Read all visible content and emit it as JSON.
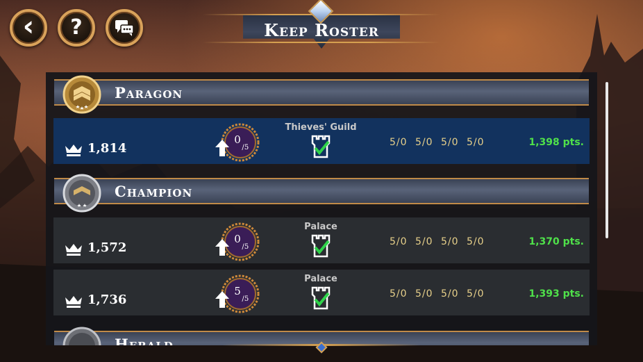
{
  "title": "Keep Roster",
  "nav": {
    "back_icon": "‹",
    "help_icon": "?",
    "chat_icon": "chat-bubbles-icon"
  },
  "tiers": [
    {
      "name": "Paragon",
      "rows": [
        {
          "power": "1,814",
          "rank_current": "0",
          "rank_max": "5",
          "guild": "Thieves' Guild",
          "stats": "5/0 5/0 5/0 5/0",
          "points": "1,398 pts.",
          "selected": true
        }
      ]
    },
    {
      "name": "Champion",
      "rows": [
        {
          "power": "1,572",
          "rank_current": "0",
          "rank_max": "5",
          "guild": "Palace",
          "stats": "5/0 5/0 5/0 5/0",
          "points": "1,370 pts.",
          "selected": false
        },
        {
          "power": "1,736",
          "rank_current": "5",
          "rank_max": "5",
          "guild": "Palace",
          "stats": "5/0 5/0 5/0 5/0",
          "points": "1,393 pts.",
          "selected": false
        }
      ]
    },
    {
      "name": "Herald",
      "rows": []
    }
  ],
  "colors": {
    "selected_row": "#12325e",
    "row": "#2a2d31",
    "points": "#4fe04a",
    "stats": "#e7d08a",
    "gold_trim": "#d6a050",
    "rank_badge": "#3a1d57"
  }
}
